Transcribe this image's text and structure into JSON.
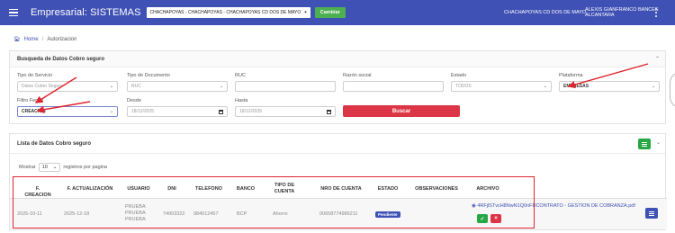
{
  "navbar": {
    "brand": "Empresarial: SISTEMAS",
    "company_select": "CHACHAPOYAS - CHACHAPOYAS - CHACHAPOYAS CD DOS DE MAYO",
    "change_button": "Cambiar",
    "branch": "CHACHAPOYAS CD DOS DE MAYO",
    "user": "ALEXIS GIANFRANCO BANCES ALCANTARA"
  },
  "breadcrumb": {
    "home": "Home",
    "separator": "/",
    "current": "Autorizacion"
  },
  "search_card": {
    "title": "Busqueda de Datos Cobro seguro",
    "tipo_servicio": {
      "label": "Tipo de Servicio",
      "value": "Datos Cobro Seguro"
    },
    "tipo_documento": {
      "label": "Tipo de Documento",
      "value": "RUC"
    },
    "ruc": {
      "label": "RUC",
      "value": ""
    },
    "razon_social": {
      "label": "Razón social",
      "value": ""
    },
    "estado": {
      "label": "Estado",
      "value": "TODOS"
    },
    "plataforma": {
      "label": "Plataforma",
      "value": "EMPRESAS"
    },
    "filtro_fecha": {
      "label": "Filtro Fecha",
      "value": "CREACION"
    },
    "desde": {
      "label": "Desde",
      "value": "18/12/2025"
    },
    "hasta": {
      "label": "Hasta",
      "value": "18/12/2025"
    },
    "search_button": "Buscar"
  },
  "list_card": {
    "title": "Lista de Datos Cobro seguro",
    "show_label": "Mostrar",
    "page_size": "10",
    "entries_label": "registros por pagina",
    "columns": [
      "F. CREACION",
      "F. ACTUALIZACIÓN",
      "USUARIO",
      "DNI",
      "TELEFONO",
      "BANCO",
      "TIPO DE CUENTA",
      "NRO DE CUENTA",
      "ESTADO",
      "OBSERVACIONES",
      "ARCHIVO"
    ],
    "rows": [
      {
        "f_creacion": "2025-10-11",
        "f_actualizacion": "2025-12-18",
        "usuario": [
          "PRUEBA",
          "PRUEBA",
          "PRUEBA"
        ],
        "dni": "74003322",
        "telefono": "984012457",
        "banco": "BCP",
        "tipo_cuenta": "Ahorro",
        "nro_cuenta": "00658774986211",
        "estado": "Pendiente",
        "observaciones": "",
        "archivo": "4RFjlSTvcH8NwN1Q0nFDCONTRATO - GESTION DE COBRANZA.pdf"
      }
    ]
  },
  "colors": {
    "navbar": "#3f51b5",
    "change": "#4caf50",
    "search": "#dc3545",
    "annotation": "#e0252f"
  }
}
